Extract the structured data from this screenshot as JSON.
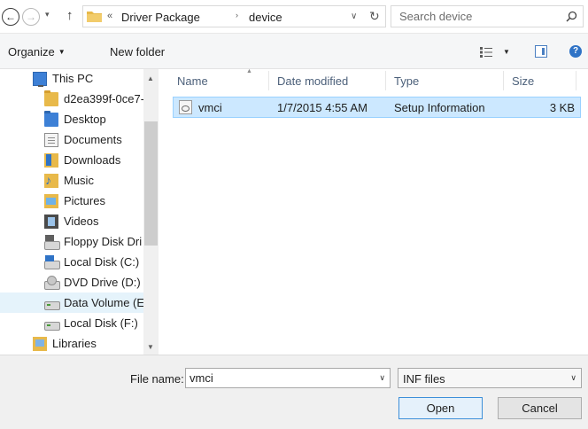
{
  "address_bar": {
    "recent_chevron": "▾",
    "overflow": "«",
    "crumbs": [
      "Driver Package",
      "device"
    ],
    "separator": "›"
  },
  "search": {
    "placeholder": "Search device"
  },
  "toolbar": {
    "organize_label": "Organize",
    "new_folder_label": "New folder"
  },
  "nav_pane": {
    "items": [
      {
        "label": "This PC",
        "icon": "computer-icon"
      },
      {
        "label": "d2ea399f-0ce7-",
        "icon": "folder-icon"
      },
      {
        "label": "Desktop",
        "icon": "desktop-folder-icon"
      },
      {
        "label": "Documents",
        "icon": "documents-icon"
      },
      {
        "label": "Downloads",
        "icon": "downloads-icon"
      },
      {
        "label": "Music",
        "icon": "music-icon"
      },
      {
        "label": "Pictures",
        "icon": "pictures-icon"
      },
      {
        "label": "Videos",
        "icon": "videos-icon"
      },
      {
        "label": "Floppy Disk Dri",
        "icon": "floppy-drive-icon"
      },
      {
        "label": "Local Disk (C:)",
        "icon": "system-drive-icon"
      },
      {
        "label": "DVD Drive (D:)",
        "icon": "dvd-drive-icon"
      },
      {
        "label": "Data Volume (E",
        "icon": "drive-icon",
        "selected": true
      },
      {
        "label": "Local Disk (F:)",
        "icon": "drive-icon"
      },
      {
        "label": "Libraries",
        "icon": "libraries-icon"
      }
    ]
  },
  "file_list": {
    "columns": [
      "Name",
      "Date modified",
      "Type",
      "Size"
    ],
    "rows": [
      {
        "name": "vmci",
        "date_modified": "1/7/2015 4:55 AM",
        "type": "Setup Information",
        "size": "3 KB",
        "selected": true
      }
    ]
  },
  "bottom": {
    "file_name_label": "File name:",
    "file_name_value": "vmci",
    "file_type_value": "INF files",
    "open_label": "Open",
    "cancel_label": "Cancel"
  },
  "colors": {
    "selection_bg": "#cce8ff",
    "selection_border": "#99d1ff",
    "nav_selected_bg": "#e5f3fb",
    "accent": "#2f73c6"
  }
}
